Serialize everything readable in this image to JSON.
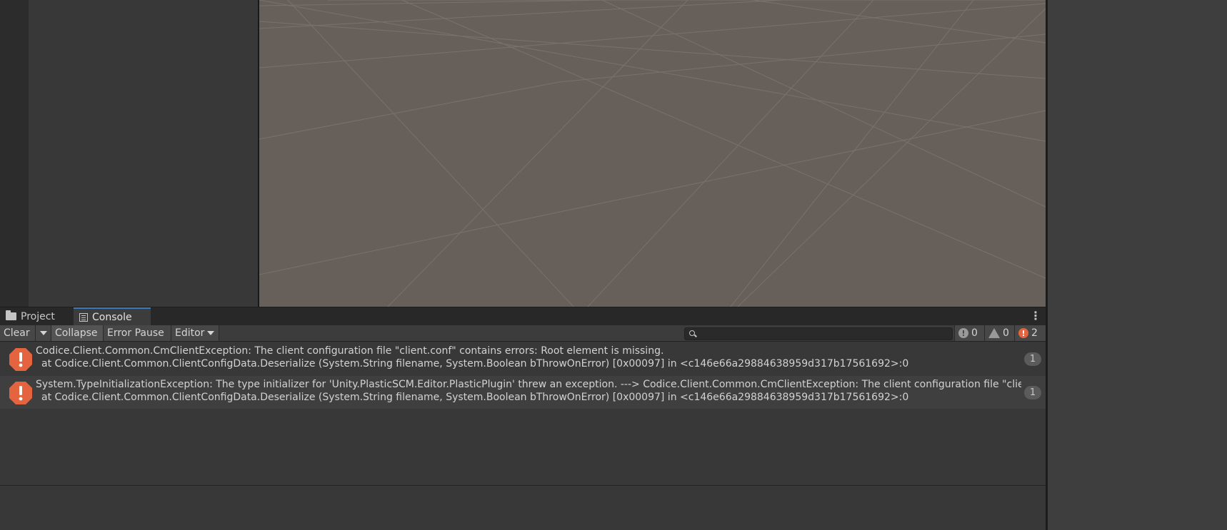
{
  "bottom_dock": {
    "tabs": [
      {
        "label": "Project",
        "icon": "folder-icon"
      },
      {
        "label": "Console",
        "icon": "console-icon"
      }
    ],
    "menu_icon": "kebab-menu-icon"
  },
  "toolbar": {
    "clear_label": "Clear",
    "collapse_label": "Collapse",
    "error_pause_label": "Error Pause",
    "editor_label": "Editor",
    "search_placeholder": "",
    "info_count": "0",
    "warning_count": "0",
    "error_count": "2"
  },
  "logs": [
    {
      "type": "error",
      "line1": "Codice.Client.Common.CmClientException: The client configuration file \"client.conf\" contains errors: Root element is missing.",
      "line2": "at Codice.Client.Common.ClientConfigData.Deserialize (System.String filename, System.Boolean bThrowOnError) [0x00097] in <c146e66a29884638959d317b17561692>:0",
      "count": "1"
    },
    {
      "type": "error",
      "line1": "System.TypeInitializationException: The type initializer for 'Unity.PlasticSCM.Editor.PlasticPlugin' threw an exception. ---> Codice.Client.Common.CmClientException: The client configuration file \"client.conf\" contains errors: Root element is missing.",
      "line2": "at Codice.Client.Common.ClientConfigData.Deserialize (System.String filename, System.Boolean bThrowOnError) [0x00097] in <c146e66a29884638959d317b17561692>:0",
      "count": "1"
    }
  ],
  "colors": {
    "scene_background": "#675f59",
    "error_accent": "#e4643f",
    "panel_background": "#383838"
  }
}
